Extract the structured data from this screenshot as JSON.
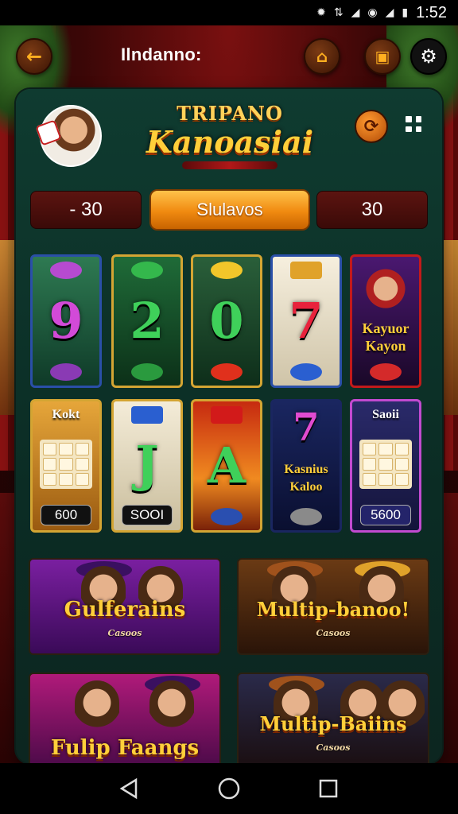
{
  "status_bar": {
    "time": "1:52"
  },
  "header": {
    "title": "Ilndanno:"
  },
  "logo": {
    "line1": "TRIPANO",
    "line2": "Kanoasiai"
  },
  "bet": {
    "left_value": "- 30",
    "spin_label": "Slulavos",
    "right_value": "30"
  },
  "reels": {
    "row1": [
      {
        "glyph": "9",
        "color": "#d24ad8"
      },
      {
        "glyph": "2",
        "color": "#3fd05a"
      },
      {
        "glyph": "0",
        "color": "#ffcf3a"
      },
      {
        "glyph": "7",
        "color": "#e8223c"
      },
      {
        "label": "Kayuor Kayon",
        "color": "#ffcf3a"
      }
    ],
    "row2": [
      {
        "label": "Kokt",
        "pill": "600"
      },
      {
        "glyph": "J",
        "pill": "SOOI"
      },
      {
        "glyph": "A",
        "color": "#3fd05a"
      },
      {
        "glyph": "7",
        "label": "Kasnius Kaloo",
        "color": "#e04bd0"
      },
      {
        "label": "Saoii",
        "pill": "5600"
      }
    ]
  },
  "games": [
    {
      "title": "Gulferains",
      "sub": "Casoos"
    },
    {
      "title": "Multip-banoo!",
      "sub": "Casoos"
    },
    {
      "title": "Fulip Faangs",
      "sub": ""
    },
    {
      "title": "Multip-Baiins",
      "sub": "Casoos"
    }
  ]
}
